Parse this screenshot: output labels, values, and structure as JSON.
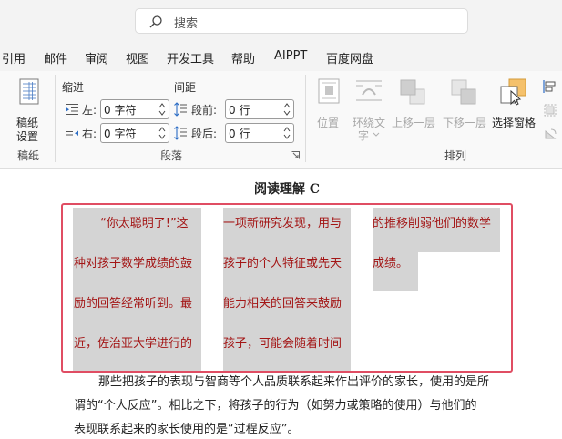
{
  "search": {
    "placeholder": "搜索"
  },
  "menu": [
    "引用",
    "邮件",
    "审阅",
    "视图",
    "开发工具",
    "帮助",
    "AIPPT",
    "百度网盘"
  ],
  "ribbon": {
    "page_setup": {
      "button_label_1": "稿纸",
      "button_label_2": "设置",
      "group_label": "稿纸"
    },
    "paragraph": {
      "indent_header": "缩进",
      "spacing_header": "间距",
      "left_label": "左:",
      "left_value": "0 字符",
      "right_label": "右:",
      "right_value": "0 字符",
      "before_label": "段前:",
      "before_value": "0 行",
      "after_label": "段后:",
      "after_value": "0 行",
      "group_label": "段落"
    },
    "arrange": {
      "position": "位置",
      "wrap_text_1": "环绕文",
      "wrap_text_2": "字",
      "bring_forward": "上移一层",
      "send_backward": "下移一层",
      "selection_pane": "选择窗格",
      "group_label": "排列"
    }
  },
  "document": {
    "title": "阅读理解 C",
    "columns": [
      [
        "“你太聪明了!”这",
        "种对孩子数学成绩的鼓",
        "励的回答经常听到。最",
        "近，佐治亚大学进行的"
      ],
      [
        "一项新研究发现，用与",
        "孩子的个人特征或先天",
        "能力相关的回答来鼓励",
        "孩子，可能会随着时间"
      ],
      [
        "的推移削弱他们的数学",
        "成绩。"
      ]
    ],
    "paragraph": [
      "那些把孩子的表现与智商等个人品质联系起来作出评价的家长，使用的是所",
      "谓的“个人反应”。相比之下，将孩子的行为（如努力或策略的使用）与他们的",
      "表现联系起来的家长使用的是“过程反应”。"
    ]
  },
  "colors": {
    "frame": "#e04d63",
    "column_text": "#a31515",
    "highlight": "#d4d4d4",
    "selection_icon": "#f5c16c"
  }
}
